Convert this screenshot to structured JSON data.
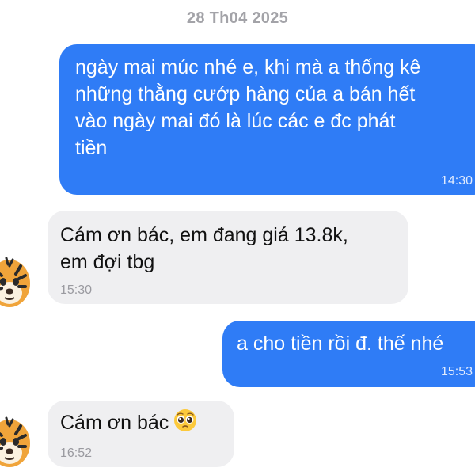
{
  "conversation": {
    "date_separator": "28 Th04 2025",
    "messages": [
      {
        "direction": "outgoing",
        "text": "ngày mai múc nhé e, khi mà a thống kê\nnhững thằng cướp hàng của a bán hết\nvào ngày mai đó là lúc các e đc phát\ntiền",
        "time": "14:30"
      },
      {
        "direction": "incoming",
        "text": "Cám ơn bác, em đang giá 13.8k,\nem đợi tbg",
        "time": "15:30",
        "sender_avatar": "tiger-avatar"
      },
      {
        "direction": "outgoing",
        "text": "a cho tiền rồi đ. thế nhé",
        "time": "15:53"
      },
      {
        "direction": "incoming",
        "text": "Cám ơn bác",
        "emoji": "pleading-face-emoji",
        "time": "16:52",
        "sender_avatar": "tiger-avatar"
      }
    ]
  },
  "colors": {
    "outgoing_bubble": "#2f7cf6",
    "incoming_bubble": "#efeff1",
    "date_text": "#a3a3a8"
  }
}
